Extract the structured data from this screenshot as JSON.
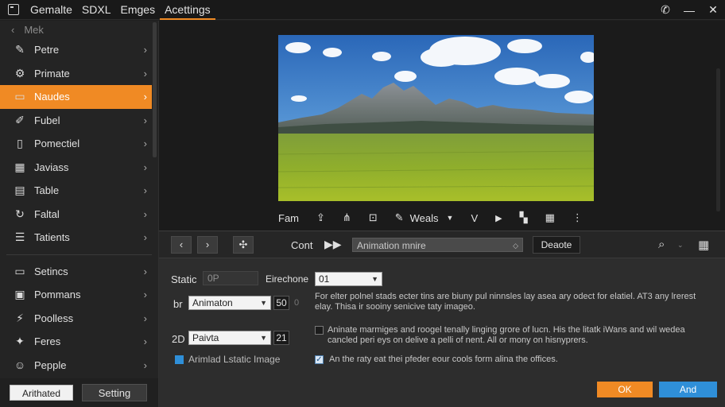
{
  "topbar": {
    "menu": [
      "Gemalte",
      "SDXL",
      "Emges",
      "Acettings"
    ],
    "active_index": 3,
    "icons": [
      "phone-icon",
      "minimize-icon",
      "close-icon"
    ]
  },
  "sidebar": {
    "back_label": "Mek",
    "items": [
      {
        "label": "Petre",
        "icon": "pen-icon"
      },
      {
        "label": "Primate",
        "icon": "gear-icon"
      },
      {
        "label": "Naudes",
        "icon": "folder-icon",
        "selected": true
      },
      {
        "label": "Fubel",
        "icon": "brush-icon"
      },
      {
        "label": "Pomectiel",
        "icon": "document-icon"
      },
      {
        "label": "Javiass",
        "icon": "grid-icon"
      },
      {
        "label": "Table",
        "icon": "table-icon"
      },
      {
        "label": "Faltal",
        "icon": "refresh-icon"
      },
      {
        "label": "Tatients",
        "icon": "list-icon"
      }
    ],
    "items_bottom": [
      {
        "label": "Setincs",
        "icon": "card-icon"
      },
      {
        "label": "Pommans",
        "icon": "clipboard-icon"
      },
      {
        "label": "Poolless",
        "icon": "bolt-icon"
      },
      {
        "label": "Feres",
        "icon": "fire-icon"
      },
      {
        "label": "Pepple",
        "icon": "people-icon"
      }
    ],
    "btn_primary": "Arithated",
    "btn_secondary": "Setting"
  },
  "media_toolbar": {
    "label_left": "Fam",
    "label_mid": "Weals",
    "label_v": "V"
  },
  "panel": {
    "cont_label": "Cont",
    "animation_select": "Animation mnire",
    "delete_label": "Deaote",
    "form": {
      "static_label": "Static",
      "static_value": "0P",
      "eirechone_label": "Eirechone",
      "eirechone_value": "01",
      "row2_label": "br",
      "row2_select": "Animaton",
      "row2_num": "50",
      "row2_suffix": "0",
      "row2_desc": "For elter polnel stads ecter tins are biuny pul ninnsles lay asea ary odect for elatiel. AT3 any lrerest elay. Thisa ir sooiny senicive taty imageo.",
      "row3_label": "2D",
      "row3_select": "Paivta",
      "row3_num": "21",
      "row3_desc": "Aninate marmiges and roogel tenally linging grore of lucn. His the litatk iWans and wil wedea cancled peri eys on delive a pelli of nent. All or mony on hisnyprers.",
      "checkbox_left": "Arimlad Lstatic Image",
      "checkbox_right": "An the raty eat thei pfeder eour cools form alina the offices."
    },
    "btn_ok": "OK",
    "btn_and": "And"
  },
  "colors": {
    "accent": "#f08a24",
    "blue": "#2f8fd8"
  }
}
